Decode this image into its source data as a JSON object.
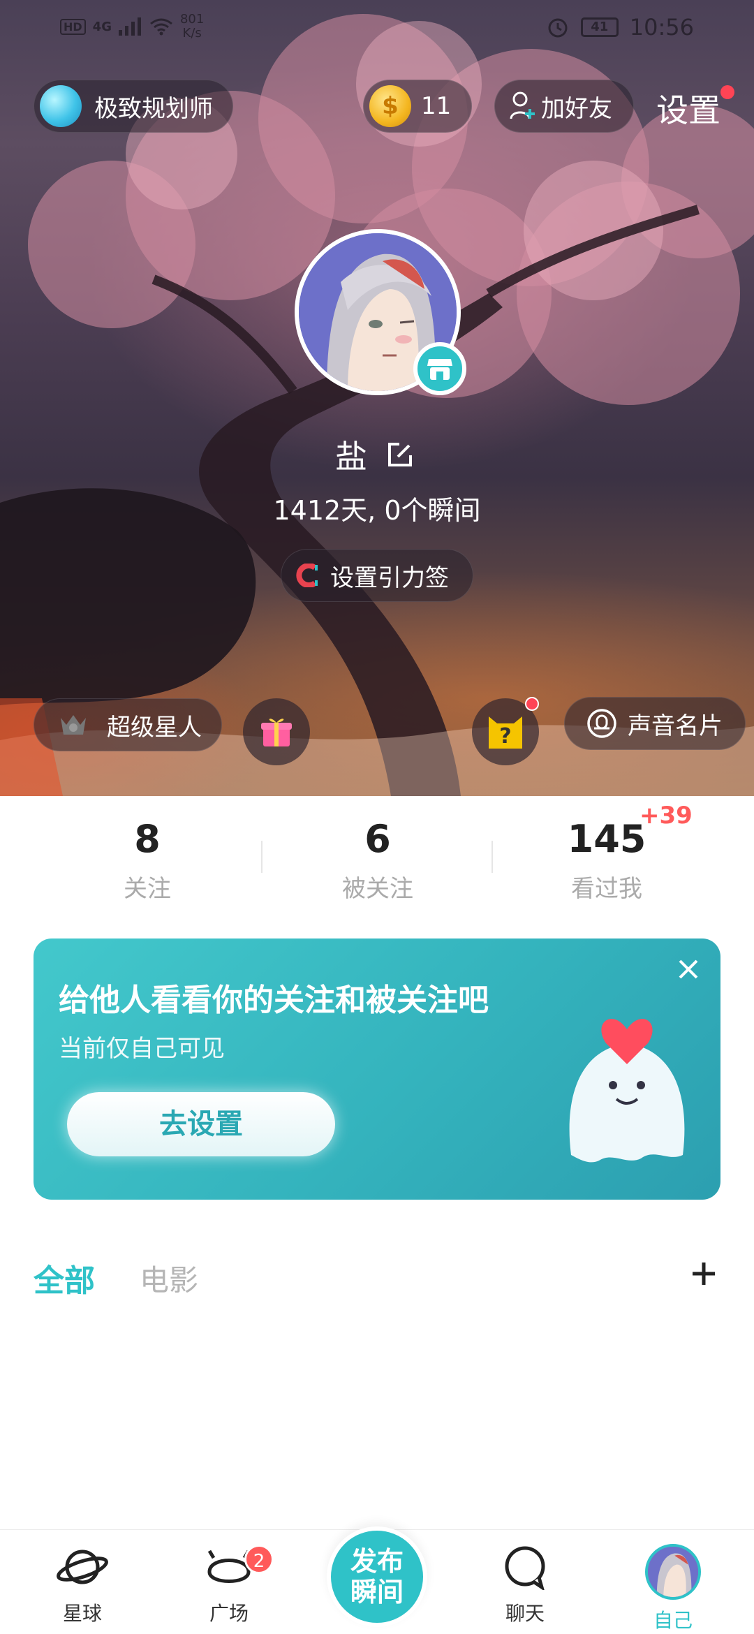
{
  "status_bar": {
    "hd": "HD",
    "network": "4G",
    "speed_value": "801",
    "speed_unit": "K/s",
    "battery": "41",
    "time": "10:56"
  },
  "header": {
    "planner_label": "极致规划师",
    "coin_symbol": "$",
    "coin_count": "11",
    "add_friend_label": "加好友",
    "settings_label": "设置"
  },
  "profile": {
    "name": "盐",
    "meta": "1412天, 0个瞬间",
    "gravity_tag_label": "设置引力签",
    "vip_label": "超级星人",
    "voice_card_label": "声音名片"
  },
  "stats": [
    {
      "value": "8",
      "label": "关注"
    },
    {
      "value": "6",
      "label": "被关注"
    },
    {
      "value": "145",
      "label": "看过我",
      "delta": "+39"
    }
  ],
  "banner": {
    "title": "给他人看看你的关注和被关注吧",
    "subtitle": "当前仅自己可见",
    "button_label": "去设置"
  },
  "tabs": [
    {
      "label": "全部",
      "active": true
    },
    {
      "label": "电影",
      "active": false
    }
  ],
  "bottom_nav": {
    "items": [
      {
        "label": "星球",
        "icon": "planet-icon"
      },
      {
        "label": "广场",
        "icon": "square-icon",
        "badge": "2"
      },
      {
        "label": "聊天",
        "icon": "chat-icon"
      },
      {
        "label": "自己",
        "icon": "avatar",
        "active": true
      }
    ],
    "publish_line1": "发布",
    "publish_line2": "瞬间"
  },
  "colors": {
    "accent": "#2fc2c8",
    "badge_red": "#ff5a5a",
    "banner": "#3ab8c2"
  }
}
